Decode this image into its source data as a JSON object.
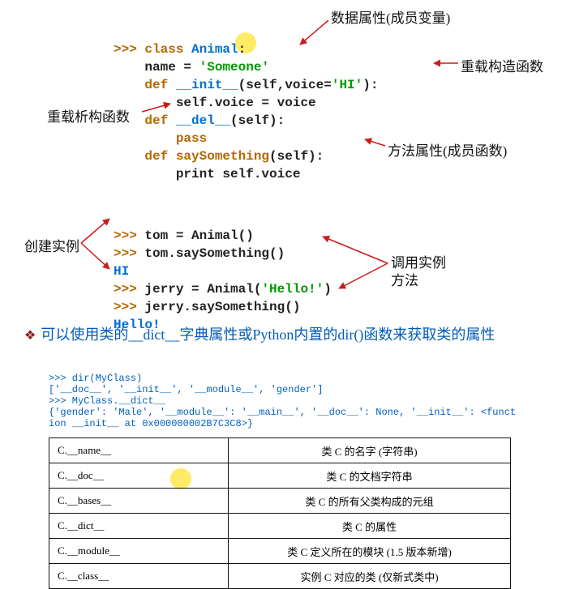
{
  "annotations": {
    "data_attr": "数据属性(成员变量)",
    "ctor": "重载构造函数",
    "dtor": "重载析构函数",
    "method_attr": "方法属性(成员函数)",
    "create_instance": "创建实例",
    "call_method_line1": "调用实例",
    "call_method_line2": "方法"
  },
  "code1": {
    "l1_prompt": ">>> ",
    "l1_kw": "class ",
    "l1_cls": "Animal",
    "l1_colon": ":",
    "l2": "    name = ",
    "l2_str": "'Someone'",
    "l3_kw": "    def ",
    "l3_mag": "__init__",
    "l3_rest": "(self,voice=",
    "l3_str": "'HI'",
    "l3_end": "):",
    "l4": "        self.voice = voice",
    "l5_kw": "    def ",
    "l5_mag": "__del__",
    "l5_rest": "(self):",
    "l6": "        pass",
    "l7_kw": "    def ",
    "l7_fn": "saySomething",
    "l7_rest": "(self):",
    "l8": "        print self.voice"
  },
  "code2": {
    "l1": ">>> tom = Animal()",
    "l2": ">>> tom.saySomething()",
    "l3_out": "HI",
    "l4a": ">>> jerry = Animal(",
    "l4b": "'Hello!'",
    "l4c": ")",
    "l5": ">>> jerry.saySomething()",
    "l6_out": "Hello!"
  },
  "bullet": {
    "text_a": "可以使用类的",
    "text_b": "__dict__",
    "text_c": "字典属性或Python内置的dir()函数来获取类的属性"
  },
  "small": {
    "l1": ">>> dir(MyClass)",
    "l2": "['__doc__', '__init__', '__module__', 'gender']",
    "l3": ">>> MyClass.__dict__",
    "l4": "{'gender': 'Male', '__module__': '__main__', '__doc__': None, '__init__': <funct",
    "l5": "ion __init__ at 0x000000002B7C3C8>}"
  },
  "table": {
    "rows": [
      {
        "l": "C.__name__",
        "r": "类 C 的名字 (字符串)"
      },
      {
        "l": "C.__doc__",
        "r": "类 C 的文档字符串"
      },
      {
        "l": "C.__bases__",
        "r": "类 C 的所有父类构成的元组"
      },
      {
        "l": "C.__dict__",
        "r": "类 C 的属性"
      },
      {
        "l": "C.__module__",
        "r": "类 C 定义所在的模块 (1.5 版本新增)"
      },
      {
        "l": "C.__class__",
        "r": "实例 C 对应的类 (仅新式类中)"
      }
    ]
  }
}
